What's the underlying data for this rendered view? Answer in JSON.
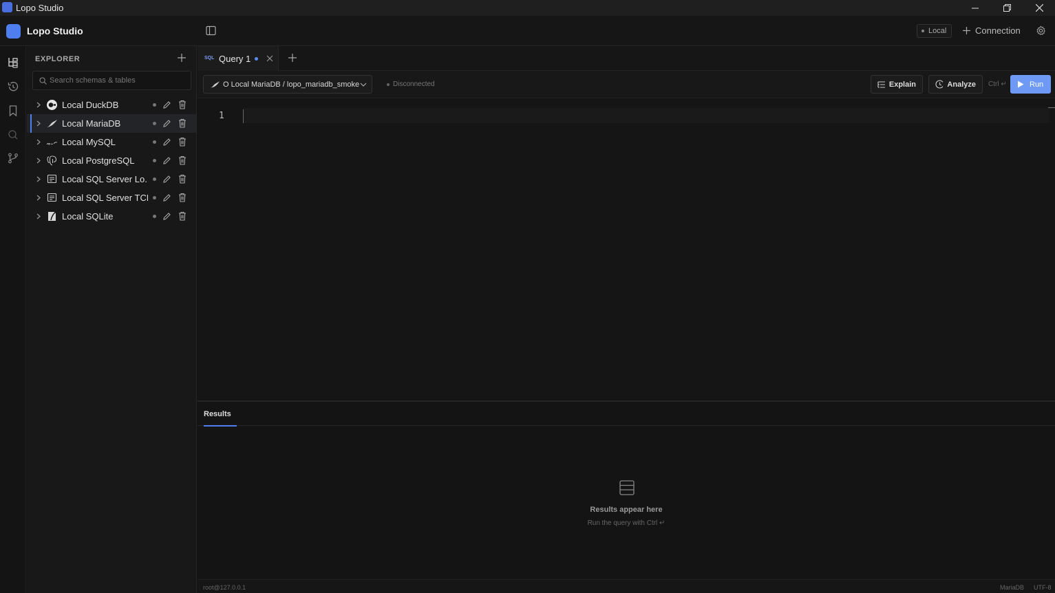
{
  "window": {
    "title": "Lopo Studio"
  },
  "header": {
    "brand": "Lopo Studio",
    "env_badge": "Local",
    "connection_label": "Connection"
  },
  "explorer": {
    "title": "EXPLORER",
    "search_placeholder": "Search schemas & tables",
    "connections": [
      {
        "name": "Local DuckDB",
        "icon": "duckdb-icon"
      },
      {
        "name": "Local MariaDB",
        "icon": "mariadb-icon",
        "active": true
      },
      {
        "name": "Local MySQL",
        "icon": "mysql-icon"
      },
      {
        "name": "Local PostgreSQL",
        "icon": "postgresql-icon"
      },
      {
        "name": "Local SQL Server Lo...",
        "icon": "sqlserver-icon"
      },
      {
        "name": "Local SQL Server TCP",
        "icon": "sqlserver-icon"
      },
      {
        "name": "Local SQLite",
        "icon": "sqlite-icon"
      }
    ]
  },
  "tabs": [
    {
      "badge": "SQL",
      "label": "Query 1",
      "modified": true
    }
  ],
  "toolbar": {
    "connection": "O Local MariaDB / lopo_mariadb_smoke",
    "status": "Disconnected",
    "explain": "Explain",
    "analyze": "Analyze",
    "shortcut": "Ctrl ↵",
    "run": "Run"
  },
  "editor": {
    "line_number": "1"
  },
  "results": {
    "tab": "Results",
    "empty_title": "Results appear here",
    "empty_subtitle": "Run the query with Ctrl ↵"
  },
  "statusbar": {
    "user": "root@127.0.0.1",
    "dialect": "MariaDB",
    "encoding": "UTF-8"
  },
  "colors": {
    "accent": "#4f7ef0",
    "run_button": "#6e9af5",
    "modified_dot": "#5b8cf5"
  }
}
